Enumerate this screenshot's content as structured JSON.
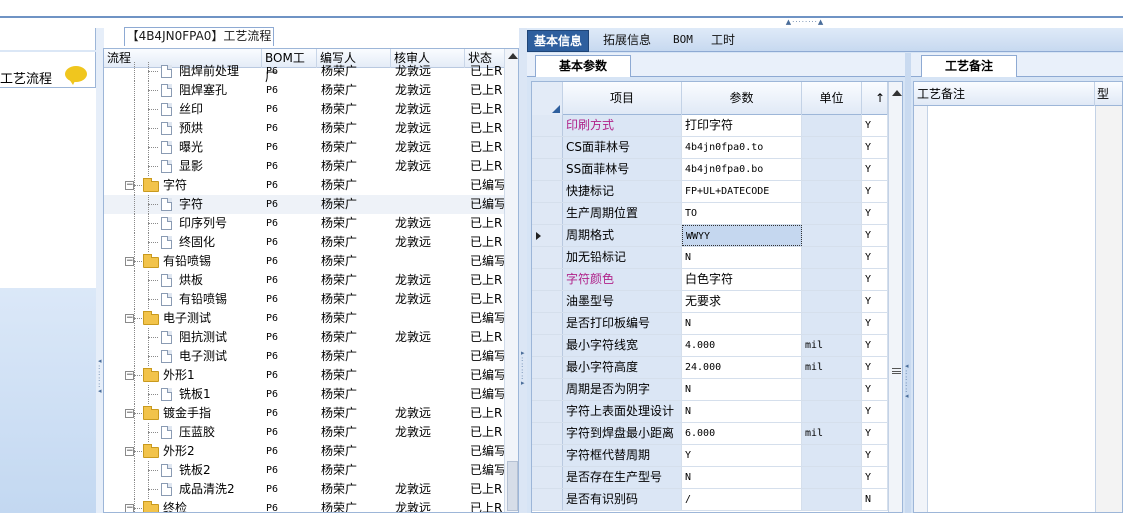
{
  "left_panel": {
    "title": "工艺流程"
  },
  "process_tab": {
    "label": "【4B4JN0FPA0】工艺流程"
  },
  "tree": {
    "columns": [
      "流程",
      "BOM工厂",
      "编写人",
      "核审人",
      "状态"
    ],
    "rows": [
      {
        "name": "阻焊前处理",
        "level": 2,
        "bom": "P6",
        "writer": "杨荣广",
        "reviewer": "龙敦远",
        "status": "已上R"
      },
      {
        "name": "阻焊塞孔",
        "level": 2,
        "bom": "P6",
        "writer": "杨荣广",
        "reviewer": "龙敦远",
        "status": "已上R"
      },
      {
        "name": "丝印",
        "level": 2,
        "bom": "P6",
        "writer": "杨荣广",
        "reviewer": "龙敦远",
        "status": "已上R"
      },
      {
        "name": "预烘",
        "level": 2,
        "bom": "P6",
        "writer": "杨荣广",
        "reviewer": "龙敦远",
        "status": "已上R"
      },
      {
        "name": "曝光",
        "level": 2,
        "bom": "P6",
        "writer": "杨荣广",
        "reviewer": "龙敦远",
        "status": "已上R"
      },
      {
        "name": "显影",
        "level": 2,
        "bom": "P6",
        "writer": "杨荣广",
        "reviewer": "龙敦远",
        "status": "已上R"
      },
      {
        "name": "字符",
        "level": 1,
        "bom": "P6",
        "writer": "杨荣广",
        "reviewer": "",
        "status": "已编写"
      },
      {
        "name": "字符",
        "level": 2,
        "bom": "P6",
        "writer": "杨荣广",
        "reviewer": "",
        "status": "已编写",
        "selected": true
      },
      {
        "name": "印序列号",
        "level": 2,
        "bom": "P6",
        "writer": "杨荣广",
        "reviewer": "龙敦远",
        "status": "已上R"
      },
      {
        "name": "终固化",
        "level": 2,
        "bom": "P6",
        "writer": "杨荣广",
        "reviewer": "龙敦远",
        "status": "已上R"
      },
      {
        "name": "有铅喷锡",
        "level": 1,
        "bom": "P6",
        "writer": "杨荣广",
        "reviewer": "",
        "status": "已编写"
      },
      {
        "name": "烘板",
        "level": 2,
        "bom": "P6",
        "writer": "杨荣广",
        "reviewer": "龙敦远",
        "status": "已上R"
      },
      {
        "name": "有铅喷锡",
        "level": 2,
        "bom": "P6",
        "writer": "杨荣广",
        "reviewer": "龙敦远",
        "status": "已上R"
      },
      {
        "name": "电子测试",
        "level": 1,
        "bom": "P6",
        "writer": "杨荣广",
        "reviewer": "",
        "status": "已编写"
      },
      {
        "name": "阻抗测试",
        "level": 2,
        "bom": "P6",
        "writer": "杨荣广",
        "reviewer": "龙敦远",
        "status": "已上R"
      },
      {
        "name": "电子测试",
        "level": 2,
        "bom": "P6",
        "writer": "杨荣广",
        "reviewer": "",
        "status": "已编写"
      },
      {
        "name": "外形1",
        "level": 1,
        "bom": "P6",
        "writer": "杨荣广",
        "reviewer": "",
        "status": "已编写"
      },
      {
        "name": "铣板1",
        "level": 2,
        "bom": "P6",
        "writer": "杨荣广",
        "reviewer": "",
        "status": "已编写"
      },
      {
        "name": "镀金手指",
        "level": 1,
        "bom": "P6",
        "writer": "杨荣广",
        "reviewer": "龙敦远",
        "status": "已上R"
      },
      {
        "name": "压蓝胶",
        "level": 2,
        "bom": "P6",
        "writer": "杨荣广",
        "reviewer": "龙敦远",
        "status": "已上R"
      },
      {
        "name": "外形2",
        "level": 1,
        "bom": "P6",
        "writer": "杨荣广",
        "reviewer": "",
        "status": "已编写"
      },
      {
        "name": "铣板2",
        "level": 2,
        "bom": "P6",
        "writer": "杨荣广",
        "reviewer": "",
        "status": "已编写"
      },
      {
        "name": "成品清洗2",
        "level": 2,
        "bom": "P6",
        "writer": "杨荣广",
        "reviewer": "龙敦远",
        "status": "已上R"
      },
      {
        "name": "终检",
        "level": 1,
        "bom": "P6",
        "writer": "杨荣广",
        "reviewer": "龙敦远",
        "status": "已上R"
      }
    ]
  },
  "main_tabs": [
    "基本信息",
    "拓展信息",
    "BOM",
    "工时"
  ],
  "sub_tab": "基本参数",
  "remarks_tab": "工艺备注",
  "params": {
    "columns": [
      "项目",
      "参数",
      "单位"
    ],
    "rows": [
      {
        "item": "印刷方式",
        "value": "打印字符",
        "unit": "",
        "flag": "Y",
        "highlight": true
      },
      {
        "item": "CS面菲林号",
        "value": "4b4jn0fpa0.to",
        "unit": "",
        "flag": "Y",
        "mono": true
      },
      {
        "item": "SS面菲林号",
        "value": "4b4jn0fpa0.bo",
        "unit": "",
        "flag": "Y",
        "mono": true
      },
      {
        "item": "快捷标记",
        "value": "FP+UL+DATECODE",
        "unit": "",
        "flag": "Y",
        "mono": true
      },
      {
        "item": "生产周期位置",
        "value": "TO",
        "unit": "",
        "flag": "Y",
        "mono": true
      },
      {
        "item": "周期格式",
        "value": "WWYY",
        "unit": "",
        "flag": "Y",
        "mono": true,
        "current": true
      },
      {
        "item": "加无铅标记",
        "value": "N",
        "unit": "",
        "flag": "Y",
        "mono": true
      },
      {
        "item": "字符颜色",
        "value": "白色字符",
        "unit": "",
        "flag": "Y",
        "highlight": true
      },
      {
        "item": "油墨型号",
        "value": "无要求",
        "unit": "",
        "flag": "Y"
      },
      {
        "item": "是否打印板编号",
        "value": "N",
        "unit": "",
        "flag": "Y",
        "mono": true
      },
      {
        "item": "最小字符线宽",
        "value": "4.000",
        "unit": "mil",
        "flag": "Y",
        "mono": true
      },
      {
        "item": "最小字符高度",
        "value": "24.000",
        "unit": "mil",
        "flag": "Y",
        "mono": true
      },
      {
        "item": "周期是否为阴字",
        "value": "N",
        "unit": "",
        "flag": "Y",
        "mono": true
      },
      {
        "item": "字符上表面处理设计",
        "value": "N",
        "unit": "",
        "flag": "Y",
        "mono": true
      },
      {
        "item": "字符到焊盘最小距离",
        "value": "6.000",
        "unit": "mil",
        "flag": "Y",
        "mono": true
      },
      {
        "item": "字符框代替周期",
        "value": "Y",
        "unit": "",
        "flag": "Y",
        "mono": true
      },
      {
        "item": "是否存在生产型号",
        "value": "N",
        "unit": "",
        "flag": "Y",
        "mono": true
      },
      {
        "item": "是否有识别码",
        "value": "/",
        "unit": "",
        "flag": "N",
        "mono": true
      }
    ]
  },
  "remarks": {
    "column": "工艺备注",
    "column2": "型"
  }
}
